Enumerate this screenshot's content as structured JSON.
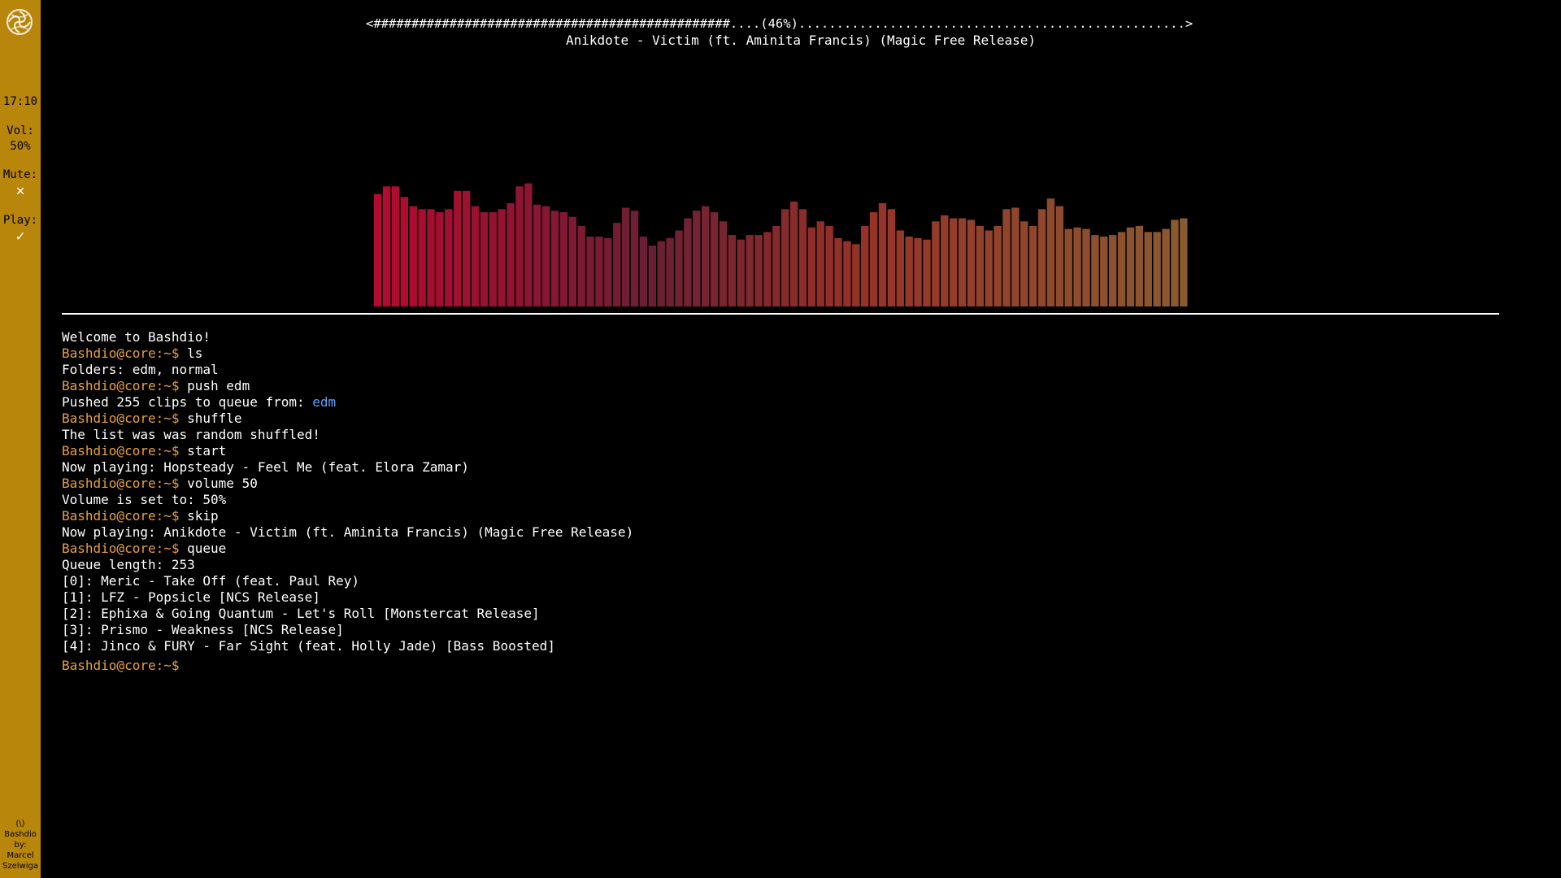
{
  "sidebar": {
    "time": "17:10",
    "volume_label": "Vol:",
    "volume_value": "50%",
    "mute_label": "Mute:",
    "mute_icon": "✕",
    "play_label": "Play:",
    "play_icon": "✓",
    "credit_1": "(\\)",
    "credit_2": "Bashdio",
    "credit_3": "by:",
    "credit_4": "Marcel",
    "credit_5": "Szelwiga"
  },
  "player": {
    "progress_text": "<###############################################....(46%)...................................................>",
    "progress_percent": 46,
    "now_playing": "Anikdote - Victim (ft. Aminita Francis) (Magic Free Release)"
  },
  "visualizer": {
    "levels": [
      0.74,
      0.79,
      0.79,
      0.72,
      0.66,
      0.64,
      0.64,
      0.62,
      0.64,
      0.76,
      0.76,
      0.66,
      0.62,
      0.62,
      0.64,
      0.68,
      0.79,
      0.81,
      0.67,
      0.66,
      0.63,
      0.62,
      0.59,
      0.53,
      0.46,
      0.46,
      0.45,
      0.55,
      0.65,
      0.63,
      0.46,
      0.4,
      0.43,
      0.45,
      0.5,
      0.58,
      0.63,
      0.66,
      0.62,
      0.56,
      0.47,
      0.44,
      0.47,
      0.47,
      0.49,
      0.53,
      0.64,
      0.69,
      0.64,
      0.52,
      0.56,
      0.53,
      0.45,
      0.43,
      0.41,
      0.53,
      0.62,
      0.68,
      0.64,
      0.5,
      0.46,
      0.45,
      0.44,
      0.56,
      0.6,
      0.58,
      0.58,
      0.57,
      0.53,
      0.5,
      0.53,
      0.64,
      0.65,
      0.56,
      0.53,
      0.64,
      0.71,
      0.66,
      0.51,
      0.52,
      0.51,
      0.47,
      0.46,
      0.47,
      0.49,
      0.52,
      0.53,
      0.49,
      0.49,
      0.51,
      0.57,
      0.58
    ],
    "color_start": "#b50a30",
    "color_mid": "#6a1f34",
    "color_end": "#8a5a30"
  },
  "terminal": {
    "lines": [
      {
        "type": "text",
        "text": "Welcome to Bashdio!"
      },
      {
        "type": "cmd",
        "prompt": "Bashdio@core:~$",
        "text": " ls"
      },
      {
        "type": "text",
        "text": "Folders: edm, normal"
      },
      {
        "type": "cmd",
        "prompt": "Bashdio@core:~$",
        "text": " push edm"
      },
      {
        "type": "link",
        "text": "Pushed 255 clips to queue from: ",
        "link": "edm"
      },
      {
        "type": "cmd",
        "prompt": "Bashdio@core:~$",
        "text": " shuffle"
      },
      {
        "type": "text",
        "text": "The list was was random shuffled!"
      },
      {
        "type": "cmd",
        "prompt": "Bashdio@core:~$",
        "text": " start"
      },
      {
        "type": "text",
        "text": "Now playing: Hopsteady - Feel Me (feat. Elora Zamar)"
      },
      {
        "type": "cmd",
        "prompt": "Bashdio@core:~$",
        "text": " volume 50"
      },
      {
        "type": "text",
        "text": "Volume is set to: 50%"
      },
      {
        "type": "cmd",
        "prompt": "Bashdio@core:~$",
        "text": " skip"
      },
      {
        "type": "text",
        "text": "Now playing: Anikdote - Victim (ft. Aminita Francis) (Magic Free Release)"
      },
      {
        "type": "cmd",
        "prompt": "Bashdio@core:~$",
        "text": " queue"
      },
      {
        "type": "text",
        "text": "Queue length: 253"
      },
      {
        "type": "text",
        "text": "[0]: Meric - Take Off (feat. Paul Rey)"
      },
      {
        "type": "text",
        "text": "[1]: LFZ - Popsicle [NCS Release]"
      },
      {
        "type": "text",
        "text": "[2]: Ephixa & Going Quantum - Let's Roll [Monstercat Release]"
      },
      {
        "type": "text",
        "text": "[3]: Prismo - Weakness [NCS Release]"
      },
      {
        "type": "text",
        "text": "[4]: Jinco & FURY - Far Sight (feat. Holly Jade) [Bass Boosted]"
      }
    ],
    "current_prompt": "Bashdio@core:~$"
  },
  "colors": {
    "sidebar_bg": "#b8860b",
    "prompt": "#e8a040",
    "link": "#5aa0ff"
  }
}
